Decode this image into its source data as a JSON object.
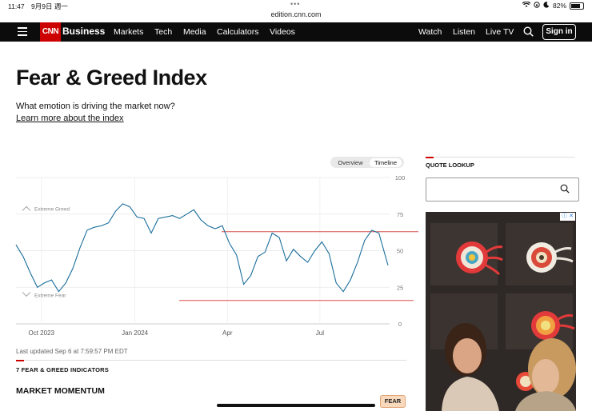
{
  "status_bar": {
    "time": "11:47",
    "date": "9月9日 週一",
    "url": "edition.cnn.com",
    "battery": "82%"
  },
  "nav": {
    "logo": "CNN",
    "section": "Business",
    "items": [
      "Markets",
      "Tech",
      "Media",
      "Calculators",
      "Videos"
    ],
    "right_items": [
      "Watch",
      "Listen",
      "Live TV"
    ],
    "signin": "Sign in"
  },
  "page": {
    "title": "Fear & Greed Index",
    "subtitle": "What emotion is driving the market now?",
    "learn_more": "Learn more about the index"
  },
  "toggle": {
    "overview": "Overview",
    "timeline": "Timeline",
    "selected": "Timeline"
  },
  "chart_data": {
    "type": "line",
    "y_ticks": [
      "100",
      "75",
      "50",
      "25",
      "0"
    ],
    "ylim": [
      0,
      100
    ],
    "x_ticks": [
      "Oct 2023",
      "Jan 2024",
      "Apr",
      "Jul"
    ],
    "zone_labels": {
      "greed": "Extreme Greed",
      "fear": "Extreme Fear"
    },
    "x": [
      "2023-09-06",
      "2023-09-13",
      "2023-09-20",
      "2023-09-27",
      "2023-10-04",
      "2023-10-11",
      "2023-10-18",
      "2023-10-25",
      "2023-11-01",
      "2023-11-08",
      "2023-11-15",
      "2023-11-22",
      "2023-11-29",
      "2023-12-06",
      "2023-12-13",
      "2023-12-20",
      "2023-12-27",
      "2024-01-03",
      "2024-01-10",
      "2024-01-17",
      "2024-01-24",
      "2024-01-31",
      "2024-02-07",
      "2024-02-14",
      "2024-02-21",
      "2024-02-28",
      "2024-03-06",
      "2024-03-13",
      "2024-03-20",
      "2024-03-27",
      "2024-04-03",
      "2024-04-10",
      "2024-04-17",
      "2024-04-24",
      "2024-05-01",
      "2024-05-08",
      "2024-05-15",
      "2024-05-22",
      "2024-05-29",
      "2024-06-05",
      "2024-06-12",
      "2024-06-19",
      "2024-06-26",
      "2024-07-03",
      "2024-07-10",
      "2024-07-17",
      "2024-07-24",
      "2024-07-31",
      "2024-08-07",
      "2024-08-14",
      "2024-08-21",
      "2024-08-28",
      "2024-09-06"
    ],
    "series": [
      {
        "values": [
          54,
          46,
          35,
          25,
          28,
          30,
          22,
          28,
          38,
          52,
          64,
          66,
          67,
          69,
          77,
          82,
          80,
          73,
          72,
          62,
          72,
          73,
          74,
          72,
          75,
          78,
          71,
          67,
          65,
          67,
          55,
          47,
          27,
          33,
          46,
          49,
          62,
          59,
          43,
          51,
          46,
          42,
          50,
          56,
          48,
          28,
          22,
          30,
          42,
          57,
          64,
          62,
          40
        ]
      }
    ],
    "reference_lines": [
      {
        "label": "upper",
        "value": 63
      },
      {
        "label": "lower",
        "value": 16
      }
    ]
  },
  "updated": "Last updated Sep 6 at 7:59:57 PM EDT",
  "indicators": {
    "heading": "7 FEAR & GREED INDICATORS",
    "first_label": "MARKET MOMENTUM",
    "first_badge": "FEAR"
  },
  "sidebar": {
    "quote_title": "QUOTE LOOKUP",
    "quote_placeholder": ""
  },
  "colors": {
    "line": "#1b6e9c",
    "ref": "#d9534f",
    "cnn_red": "#cc0000",
    "fear_badge": "#f8d9bc"
  }
}
